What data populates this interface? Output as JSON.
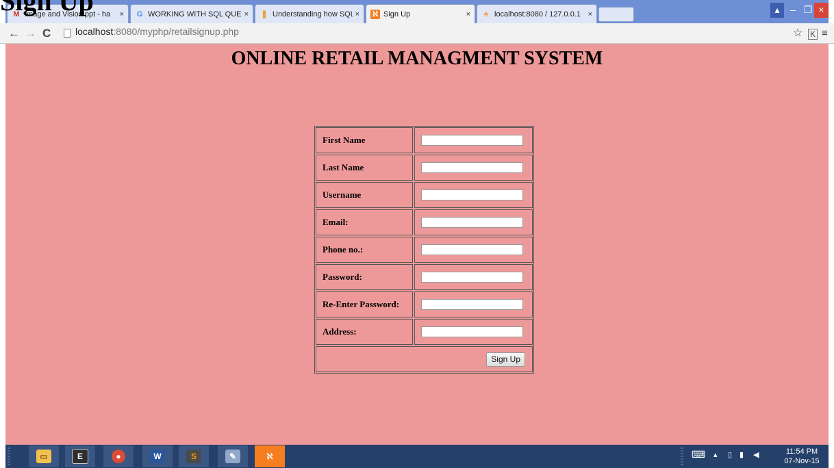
{
  "browser": {
    "tabs": [
      {
        "label": "Image and Vision ppt - ha",
        "icon": "gmail-icon"
      },
      {
        "label": "WORKING WITH SQL QUE",
        "icon": "google-icon"
      },
      {
        "label": "Understanding how SQL S",
        "icon": "bookmark-icon"
      },
      {
        "label": "Sign Up",
        "icon": "xampp-icon",
        "active": true
      },
      {
        "label": "localhost:8080 / 127.0.0.1",
        "icon": "phpmyadmin-icon"
      }
    ],
    "close_glyph": "×",
    "address": {
      "host": "localhost",
      "path": ":8080/myphp/retailsignup.php"
    }
  },
  "overlay_heading": "Sign Up",
  "page": {
    "title": "ONLINE RETAIL MANAGMENT SYSTEM",
    "form": {
      "fields": [
        {
          "label": "First Name",
          "value": ""
        },
        {
          "label": "Last Name",
          "value": ""
        },
        {
          "label": "Username",
          "value": ""
        },
        {
          "label": "Email:",
          "value": ""
        },
        {
          "label": "Phone no.:",
          "value": ""
        },
        {
          "label": "Password:",
          "value": ""
        },
        {
          "label": "Re-Enter Password:",
          "value": ""
        },
        {
          "label": "Address:",
          "value": ""
        }
      ],
      "submit_label": "Sign Up"
    }
  },
  "taskbar": {
    "apps": [
      "file-explorer-icon",
      "terminal-icon",
      "chrome-icon",
      "word-icon",
      "sublime-icon",
      "paint-icon",
      "xampp-icon"
    ],
    "clock": {
      "time": "11:54 PM",
      "date": "07-Nov-15"
    }
  },
  "colors": {
    "page_background": "#ee9999",
    "tabstrip": "#6e8fd6",
    "taskbar": "#25406a"
  }
}
